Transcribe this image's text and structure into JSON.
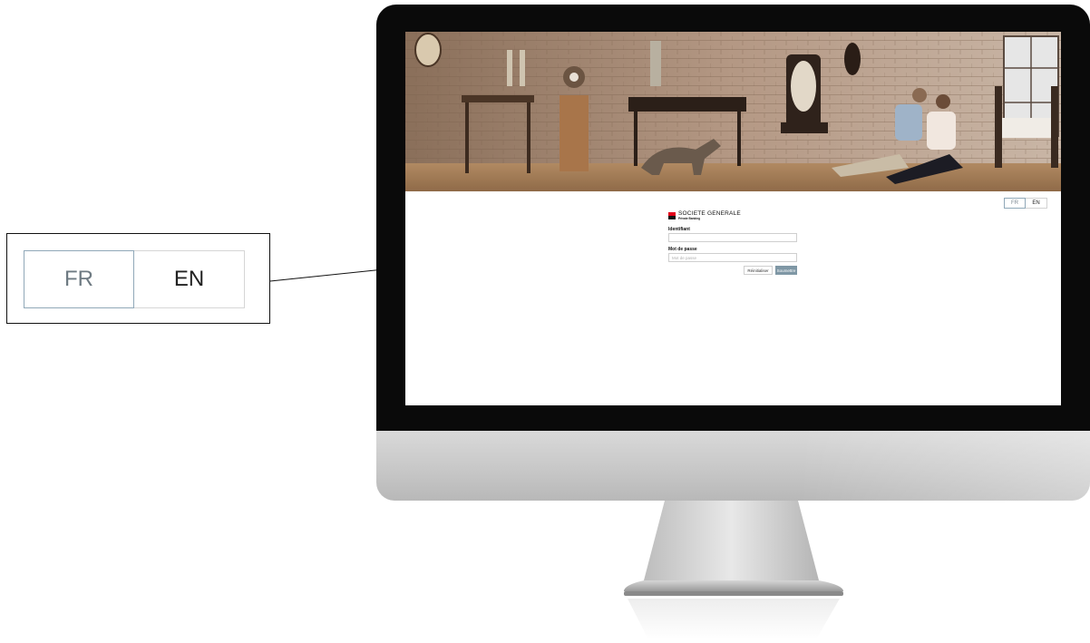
{
  "language_switch": {
    "fr_label": "FR",
    "en_label": "EN",
    "selected": "FR"
  },
  "brand": {
    "name": "SOCIETE GENERALE",
    "tagline": "Private Banking"
  },
  "login_form": {
    "identifier_label": "Identifiant",
    "identifier_value": "",
    "password_label": "Mot de passe",
    "password_placeholder": "Mot de passe",
    "reset_label": "Réinitialiser",
    "submit_label": "Soumettre"
  },
  "colors": {
    "brand_red": "#e2001a",
    "brand_black": "#111111",
    "submit_button": "#7f97a5",
    "selected_lang_border": "#90a8b8"
  }
}
